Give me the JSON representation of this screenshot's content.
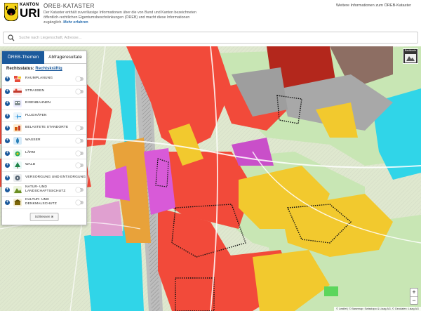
{
  "header": {
    "logo_top": "KANTON",
    "logo_big": "URI",
    "app_title": "ÖREB-KATASTER",
    "description": "Der Kataster enthält zuverlässige Informationen über die von Bund und Kanton bezeichneten öffentlich-rechtlichen Eigentumsbeschränkungen (ÖREB) und macht diese Informationen zugänglich.",
    "more_link": "Mehr erfahren",
    "info_link": "Weitere Informationen zum ÖREB-Kataster"
  },
  "search": {
    "placeholder": "Suche nach Liegenschaft, Adresse..."
  },
  "panel": {
    "tabs": [
      {
        "label": "ÖREB-Themen"
      },
      {
        "label": "Abfrageresultate"
      }
    ],
    "status_label": "Rechtsstatus:",
    "status_value": "Rechtskräftig",
    "themes": [
      {
        "label": "RAUMPLANUNG",
        "icon": "planning-icon",
        "color": "#e74c3c"
      },
      {
        "label": "STRASSEN",
        "icon": "road-icon",
        "color": "#c0392b"
      },
      {
        "label": "EISENBAHNEN",
        "icon": "train-icon",
        "color": "#7f8c8d"
      },
      {
        "label": "FLUGHÄFEN",
        "icon": "airplane-icon",
        "color": "#3498db"
      },
      {
        "label": "BELASTETE STANDORTE",
        "icon": "contaminated-site-icon",
        "color": "#d35400"
      },
      {
        "label": "WASSER",
        "icon": "water-icon",
        "color": "#2980b9"
      },
      {
        "label": "LÄRM",
        "icon": "noise-icon",
        "color": "#27ae60"
      },
      {
        "label": "WALD",
        "icon": "forest-icon",
        "color": "#1e8449"
      },
      {
        "label": "VERSORGUNG UND ENTSORGUNG",
        "icon": "utilities-icon",
        "color": "#566573"
      },
      {
        "label_line1": "NATUR- UND",
        "label_line2": "LANDSCHAFTSSCHUTZ",
        "icon": "nature-icon",
        "color": "#6b8e23"
      },
      {
        "label_line1": "KULTUR- UND",
        "label_line2": "DENKMALSCHUTZ",
        "icon": "monument-icon",
        "color": "#7d6608"
      }
    ],
    "close_label": "Schliessen ⊗"
  },
  "map": {
    "basemap_label": "Basiskarte",
    "zoom_in": "+",
    "zoom_out": "−",
    "attribution": "© Leaflet | © Basemap: Swisstopo & Lisag AG, © Geodaten: Lisag AG"
  }
}
